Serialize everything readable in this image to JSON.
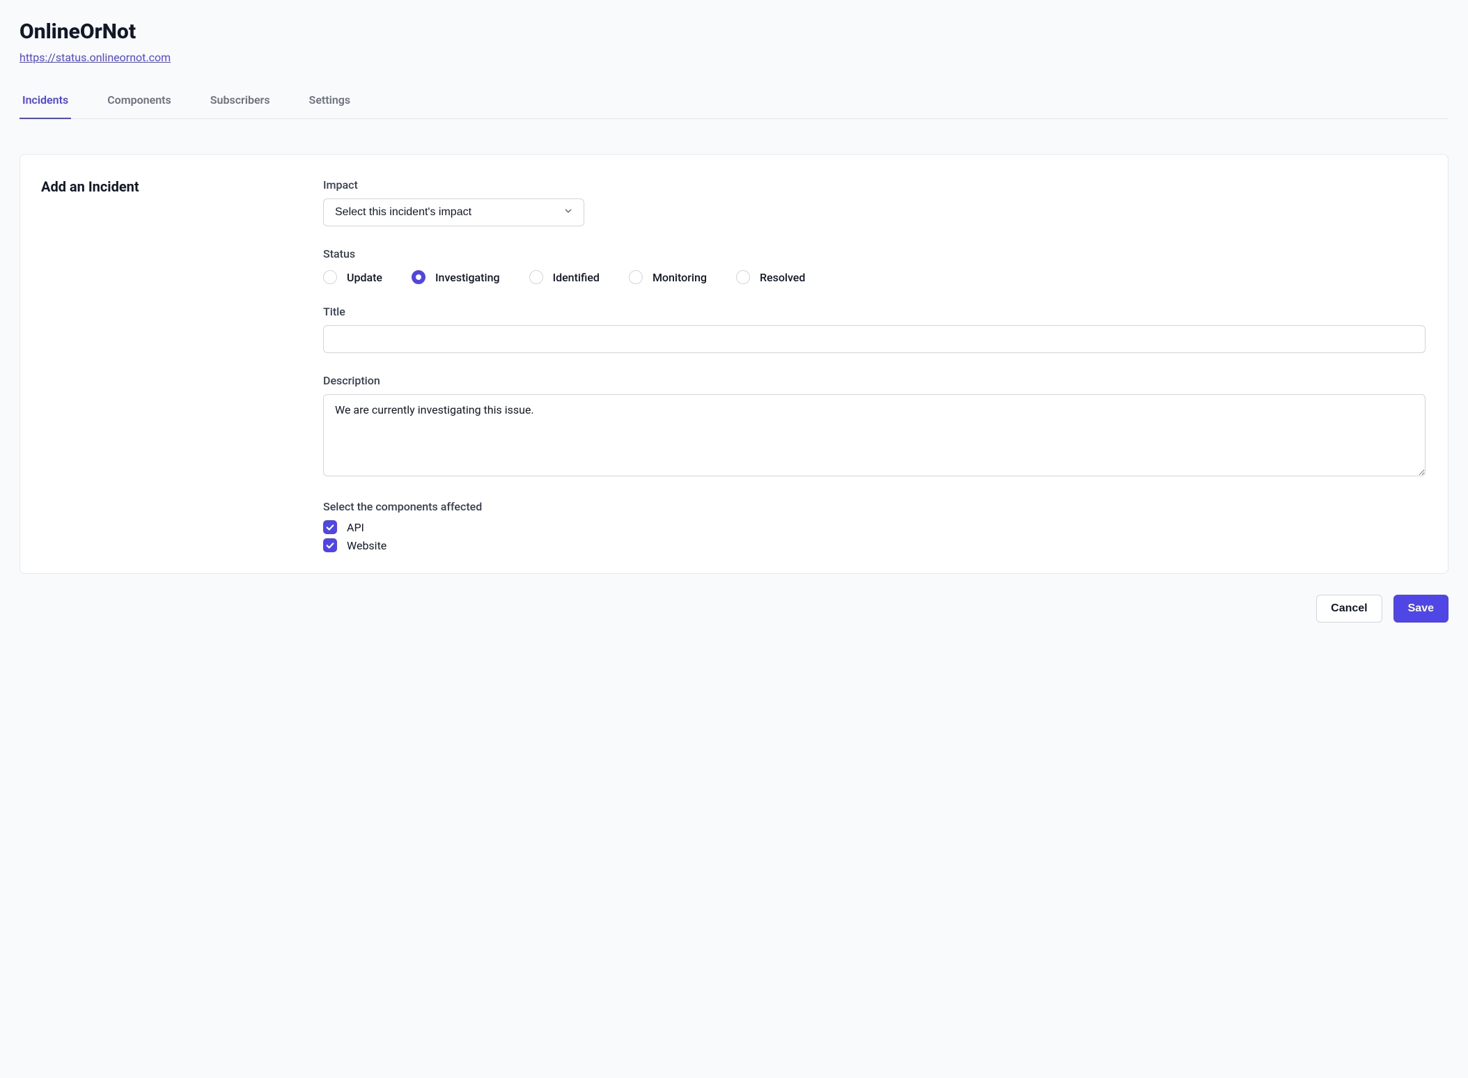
{
  "header": {
    "title": "OnlineOrNot",
    "url": "https://status.onlineornot.com"
  },
  "tabs": [
    "Incidents",
    "Components",
    "Subscribers",
    "Settings"
  ],
  "active_tab": "Incidents",
  "form": {
    "section_title": "Add an Incident",
    "impact": {
      "label": "Impact",
      "selected": "Select this incident's impact"
    },
    "status": {
      "label": "Status",
      "options": [
        "Update",
        "Investigating",
        "Identified",
        "Monitoring",
        "Resolved"
      ],
      "selected": "Investigating"
    },
    "title_field": {
      "label": "Title",
      "value": ""
    },
    "description": {
      "label": "Description",
      "value": "We are currently investigating this issue."
    },
    "components": {
      "label": "Select the components affected",
      "items": [
        {
          "label": "API",
          "checked": true
        },
        {
          "label": "Website",
          "checked": true
        }
      ]
    }
  },
  "actions": {
    "cancel": "Cancel",
    "save": "Save"
  }
}
